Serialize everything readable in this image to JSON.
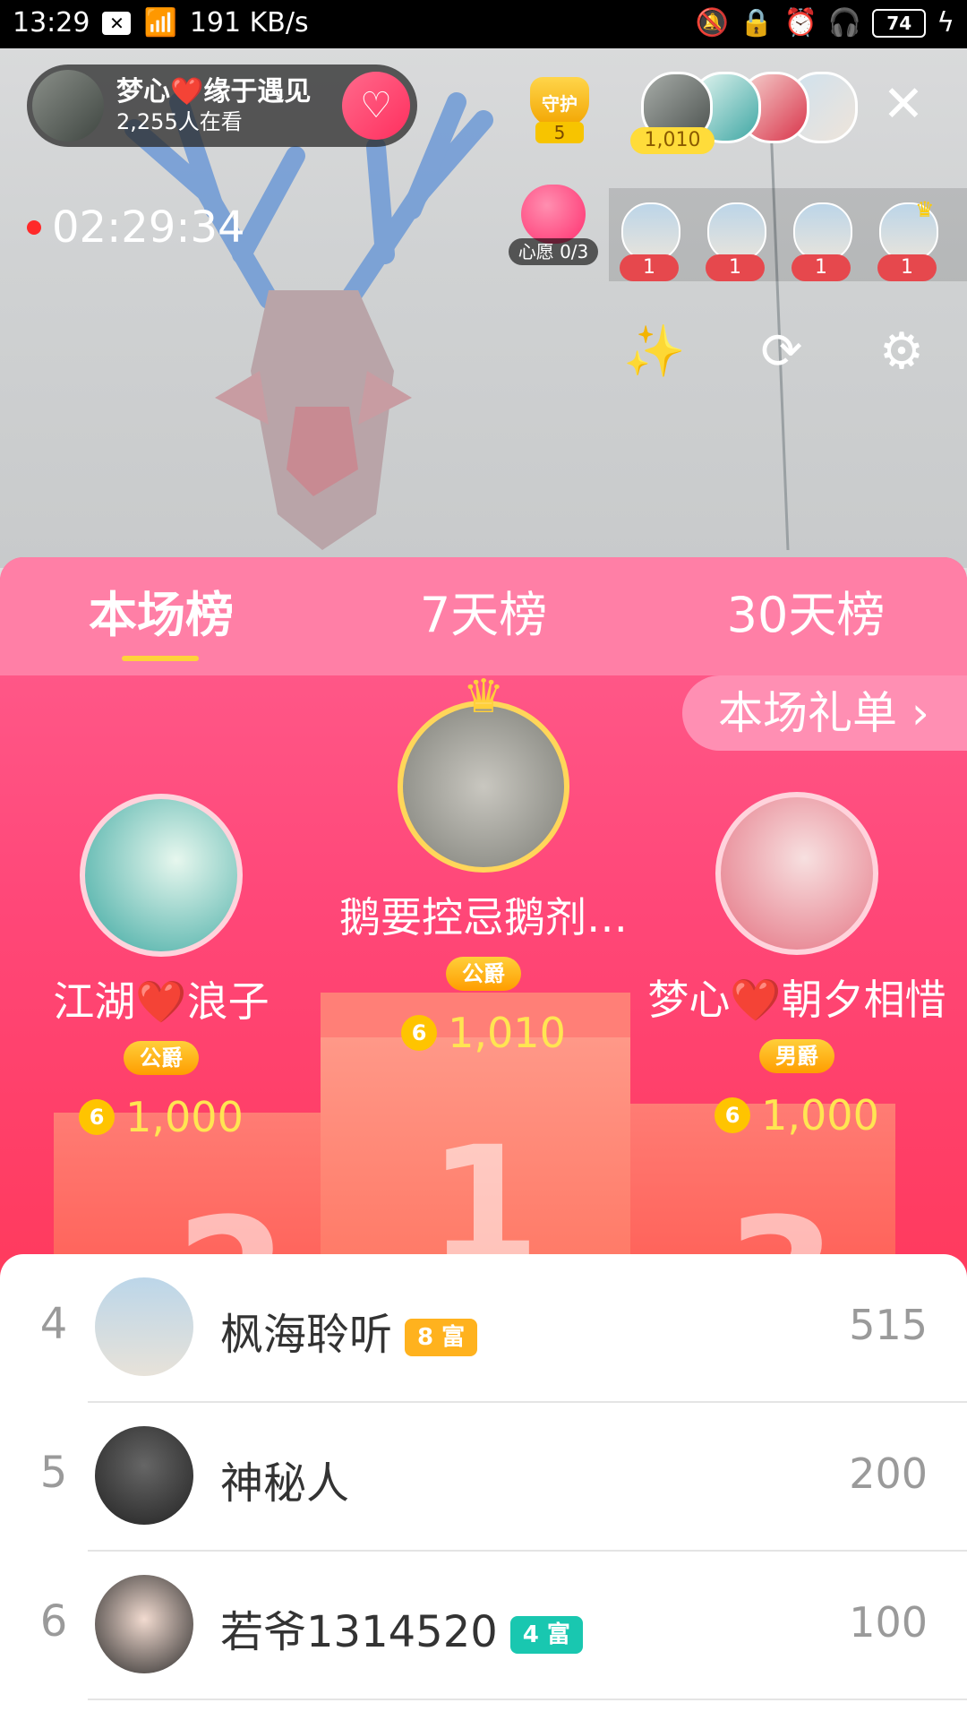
{
  "status_bar": {
    "time": "13:29",
    "notification_icon": "x-box-icon",
    "network_speed": "191 KB/s",
    "battery": "74"
  },
  "stream": {
    "host_name": "梦心❤️缘于遇见",
    "viewers": "2,255人在看",
    "guard_label": "守护",
    "guard_count": "5",
    "top_contrib_count": "1,010",
    "timer": "02:29:34",
    "wish_label": "心愿 0/3",
    "gift_counts": [
      "1",
      "1",
      "1",
      "1"
    ]
  },
  "panel": {
    "tabs": [
      "本场榜",
      "7天榜",
      "30天榜"
    ],
    "active_tab": 0,
    "gift_list_label": "本场礼单 ›",
    "top3": [
      {
        "rank": 1,
        "name": "鹅要控忌鹅剂…",
        "badge": "公爵",
        "score": "1,010"
      },
      {
        "rank": 2,
        "name": "江湖❤️浪子",
        "badge": "公爵",
        "score": "1,000"
      },
      {
        "rank": 3,
        "name": "梦心❤️朝夕相惜",
        "badge": "男爵",
        "score": "1,000"
      }
    ],
    "coin_symbol": "6",
    "podium_labels": [
      "1",
      "2",
      "3"
    ]
  },
  "ranking_list": [
    {
      "rank": "4",
      "name": "枫海聆听",
      "level": "8 富",
      "level_color": "#ffb21e",
      "score": "515"
    },
    {
      "rank": "5",
      "name": "神秘人",
      "level": "",
      "level_color": "",
      "score": "200"
    },
    {
      "rank": "6",
      "name": "若爷1314520",
      "level": "4 富",
      "level_color": "#19c7b0",
      "score": "100"
    }
  ]
}
